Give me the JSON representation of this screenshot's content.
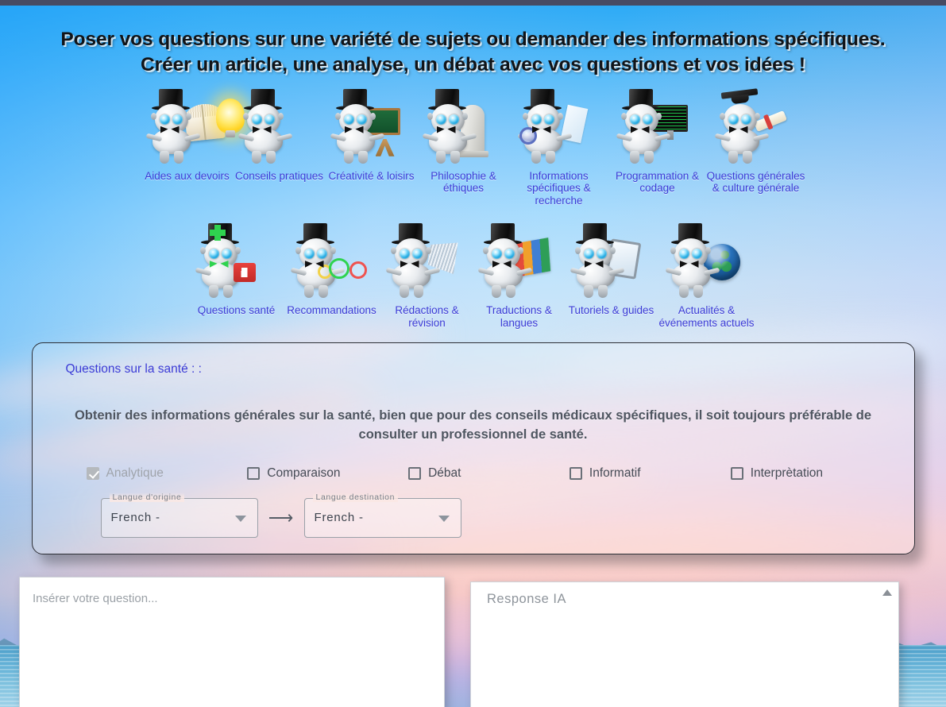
{
  "headline": "Poser vos questions sur une variété de sujets ou demander des informations spécifiques. Créer un article, une analyse, un débat avec vos questions et vos idées !",
  "colors": {
    "link_blue": "#3b3bd6",
    "topbar": "#474b63",
    "panel_border": "#2d2f36",
    "checkbox_border": "#6a7078",
    "checked_fill": "#b5b9bd"
  },
  "topics_row1": [
    {
      "label": "Aides aux devoirs",
      "icon": "robot-book-icon"
    },
    {
      "label": "Conseils pratiques",
      "icon": "robot-lightbulb-icon"
    },
    {
      "label": "Créativité & loisirs",
      "icon": "robot-easel-icon"
    },
    {
      "label": "Philosophie & éthiques",
      "icon": "robot-statue-icon"
    },
    {
      "label": "Informations spécifiques & recherche",
      "icon": "robot-magnifier-icon"
    },
    {
      "label": "Programmation & codage",
      "icon": "robot-monitor-icon"
    },
    {
      "label": "Questions générales & culture générale",
      "icon": "robot-diploma-icon"
    }
  ],
  "topics_row2": [
    {
      "label": "Questions santé",
      "icon": "robot-medkit-icon"
    },
    {
      "label": "Recommandations",
      "icon": "robot-smileys-icon"
    },
    {
      "label": "Rédactions & révision",
      "icon": "robot-broom-icon"
    },
    {
      "label": "Traductions & langues",
      "icon": "robot-films-icon"
    },
    {
      "label": "Tutoriels & guides",
      "icon": "robot-tablet-icon"
    },
    {
      "label": "Actualités & événements actuels",
      "icon": "robot-globe-icon"
    }
  ],
  "panel": {
    "title": "Questions sur la santé : :",
    "description": "Obtenir des informations générales sur la santé, bien que pour des conseils médicaux spécifiques, il soit toujours préférable de consulter un professionnel de santé.",
    "checkboxes": [
      {
        "label": "Analytique",
        "checked": true,
        "disabled": true
      },
      {
        "label": "Comparaison",
        "checked": false
      },
      {
        "label": "Débat",
        "checked": false
      },
      {
        "label": "Informatif",
        "checked": false
      },
      {
        "label": "Interprètation",
        "checked": false
      }
    ],
    "source_language": {
      "legend": "Langue d'origine",
      "value": "French -"
    },
    "target_language": {
      "legend": "Langue destination",
      "value": "French -"
    },
    "arrow_glyph": "⟶"
  },
  "inputs": {
    "question_placeholder": "Insérer votre question...",
    "answer_placeholder": "Response IA"
  }
}
